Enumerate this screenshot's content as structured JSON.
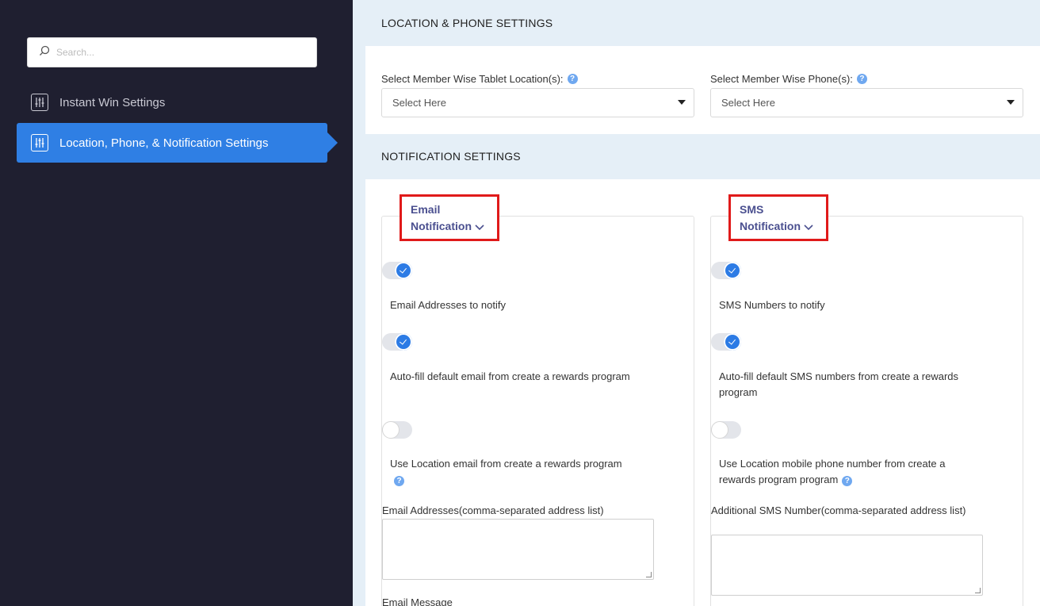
{
  "sidebar": {
    "search_placeholder": "Search...",
    "items": [
      {
        "label": "Instant Win Settings",
        "active": false
      },
      {
        "label": "Location, Phone, & Notification Settings",
        "active": true
      }
    ]
  },
  "location_phone": {
    "section_title": "LOCATION & PHONE SETTINGS",
    "tablet_label": "Select Member Wise Tablet Location(s):",
    "tablet_value": "Select Here",
    "phone_label": "Select Member Wise Phone(s):",
    "phone_value": "Select Here"
  },
  "notification": {
    "section_title": "NOTIFICATION SETTINGS",
    "email": {
      "title_line1": "Email",
      "title_line2": "Notification",
      "opt1": "Email Addresses to notify",
      "opt1_on": true,
      "opt2": "Auto-fill default email from create a rewards program",
      "opt2_on": true,
      "opt3": "Use Location email from create a rewards program",
      "opt3_on": false,
      "addresses_label": "Email Addresses(comma-separated address list)",
      "message_label": "Email Message"
    },
    "sms": {
      "title_line1": "SMS",
      "title_line2": "Notification",
      "opt1": "SMS Numbers to notify",
      "opt1_on": true,
      "opt2": "Auto-fill default SMS numbers from create a rewards program",
      "opt2_on": true,
      "opt3": "Use Location mobile phone number from create a rewards program program",
      "opt3_on": false,
      "numbers_label": "Additional SMS Number(comma-separated address list)"
    }
  },
  "colors": {
    "sidebar_bg": "#1f1f30",
    "accent": "#2f7fe4",
    "highlight_border": "#e01a1a",
    "main_bg": "#e5eff7"
  }
}
